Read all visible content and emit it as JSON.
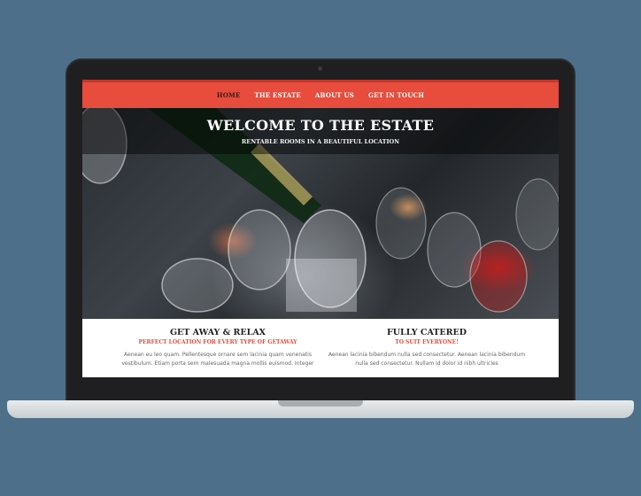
{
  "nav": {
    "items": [
      "HOME",
      "THE ESTATE",
      "ABOUT US",
      "GET IN TOUCH"
    ],
    "active": "HOME"
  },
  "hero": {
    "title": "WELCOME TO THE ESTATE",
    "subtitle": "RENTABLE ROOMS IN A BEAUTIFUL LOCATION"
  },
  "features": [
    {
      "title": "GET AWAY & RELAX",
      "subtitle": "PERFECT LOCATION FOR EVERY TYPE OF GETAWAY",
      "text": "Aenean eu leo quam. Pellentesque ornare sem lacinia quam venenatis vestibulum. Etiam porta sem malesuada magna mollis euismod. Integer"
    },
    {
      "title": "FULLY CATERED",
      "subtitle": "TO SUIT EVERYONE!",
      "text": "Aenean lacinia bibendum nulla sed consectetur. Aenean lacinia bibendum nulla sed consectetur. Nullam id dolor id nibh ultricies"
    }
  ],
  "colors": {
    "accent": "#e74c3c",
    "background": "#4e6f8a",
    "laptop_bezel": "#1f1f21"
  }
}
